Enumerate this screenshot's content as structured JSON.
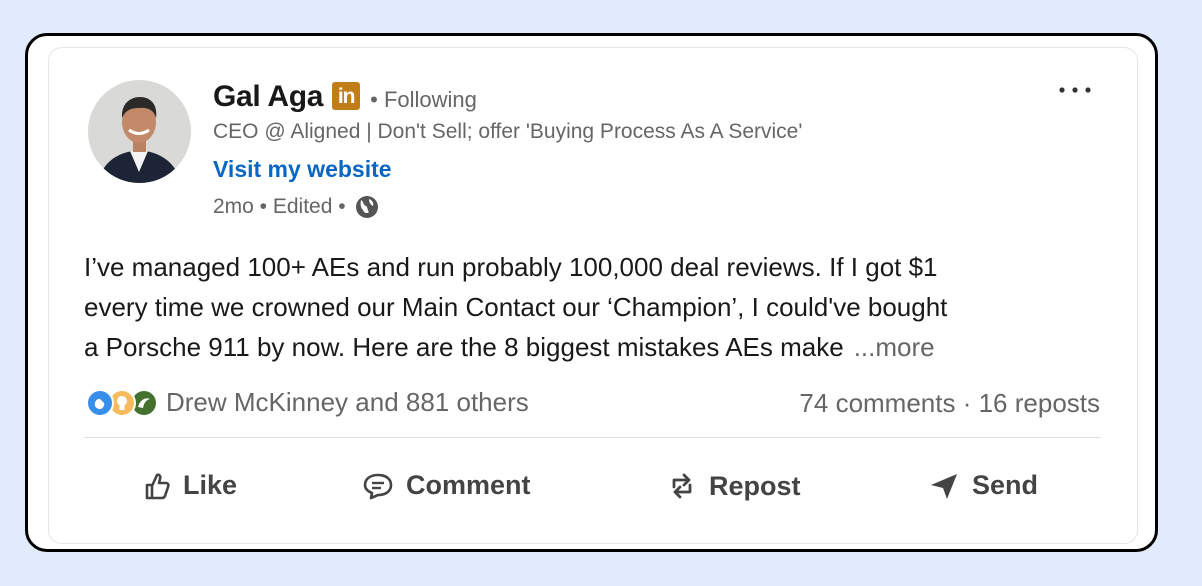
{
  "author": {
    "name": "Gal Aga",
    "badge": "in",
    "follow_status": "• Following",
    "headline": "CEO @ Aligned | Don't Sell; offer 'Buying Process As A Service'",
    "website_link": "Visit my website",
    "meta": "2mo • Edited •"
  },
  "post": {
    "line1": "I’ve managed 100+ AEs and run probably 100,000 deal reviews. If I got $1",
    "line2": "every time we crowned our Main Contact our ‘Champion’, I could've bought",
    "line3": "a Porsche 911 by now. Here are the 8 biggest mistakes AEs make",
    "see_more": "...more"
  },
  "engagement": {
    "reactions_text": "Drew McKinney and 881 others",
    "counts_text": "74 comments · 16 reposts"
  },
  "actions": {
    "like": "Like",
    "comment": "Comment",
    "repost": "Repost",
    "send": "Send"
  },
  "colors": {
    "accent_link": "#0a66c2",
    "badge": "#c37d16",
    "frame_bg": "#e1ebfb"
  },
  "icons": [
    "globe-icon",
    "more-options-icon",
    "like-icon",
    "comment-icon",
    "repost-icon",
    "send-icon",
    "clap-reaction-icon",
    "insightful-reaction-icon",
    "support-reaction-icon"
  ]
}
